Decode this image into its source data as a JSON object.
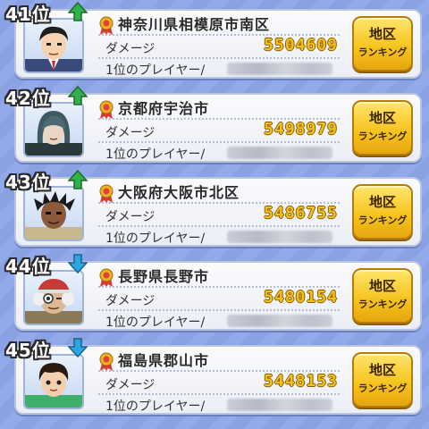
{
  "rows": [
    {
      "rank_text": "41位",
      "trend": "up",
      "prefecture": "神奈川県相模原市南区",
      "damage_label": "ダメージ",
      "damage": "5504609",
      "top_player_label": "1位のプレイヤー/",
      "button_line1": "地区",
      "button_line2": "ランキング"
    },
    {
      "rank_text": "42位",
      "trend": "up",
      "prefecture": "京都府宇治市",
      "damage_label": "ダメージ",
      "damage": "5498979",
      "top_player_label": "1位のプレイヤー/",
      "button_line1": "地区",
      "button_line2": "ランキング"
    },
    {
      "rank_text": "43位",
      "trend": "up",
      "prefecture": "大阪府大阪市北区",
      "damage_label": "ダメージ",
      "damage": "5486755",
      "top_player_label": "1位のプレイヤー/",
      "button_line1": "地区",
      "button_line2": "ランキング"
    },
    {
      "rank_text": "44位",
      "trend": "down",
      "prefecture": "長野県長野市",
      "damage_label": "ダメージ",
      "damage": "5480154",
      "top_player_label": "1位のプレイヤー/",
      "button_line1": "地区",
      "button_line2": "ランキング"
    },
    {
      "rank_text": "45位",
      "trend": "down",
      "prefecture": "福島県郡山市",
      "damage_label": "ダメージ",
      "damage": "5448153",
      "top_player_label": "1位のプレイヤー/",
      "button_line1": "地区",
      "button_line2": "ランキング"
    }
  ],
  "colors": {
    "trend_up": "#2fb24a",
    "trend_down": "#2aa6e0",
    "damage_text": "#f2c21b",
    "button_fill": "#f5c21a"
  }
}
